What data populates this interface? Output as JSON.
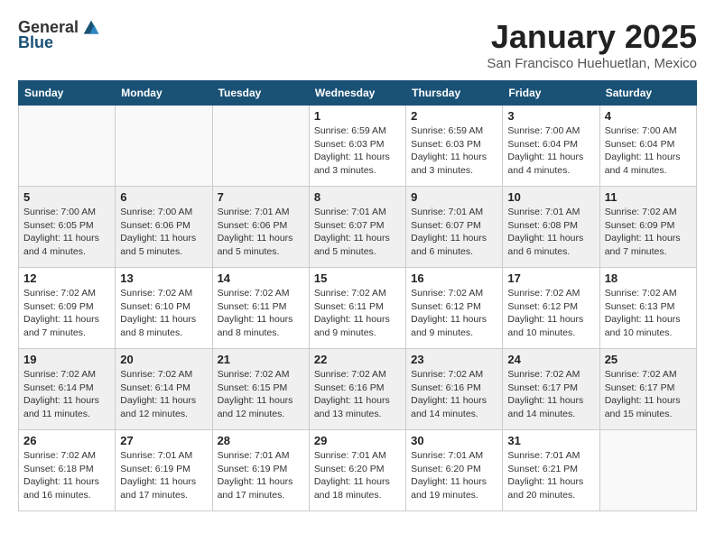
{
  "header": {
    "logo_general": "General",
    "logo_blue": "Blue",
    "title": "January 2025",
    "location": "San Francisco Huehuetlan, Mexico"
  },
  "weekdays": [
    "Sunday",
    "Monday",
    "Tuesday",
    "Wednesday",
    "Thursday",
    "Friday",
    "Saturday"
  ],
  "weeks": [
    [
      {
        "day": "",
        "info": ""
      },
      {
        "day": "",
        "info": ""
      },
      {
        "day": "",
        "info": ""
      },
      {
        "day": "1",
        "info": "Sunrise: 6:59 AM\nSunset: 6:03 PM\nDaylight: 11 hours\nand 3 minutes."
      },
      {
        "day": "2",
        "info": "Sunrise: 6:59 AM\nSunset: 6:03 PM\nDaylight: 11 hours\nand 3 minutes."
      },
      {
        "day": "3",
        "info": "Sunrise: 7:00 AM\nSunset: 6:04 PM\nDaylight: 11 hours\nand 4 minutes."
      },
      {
        "day": "4",
        "info": "Sunrise: 7:00 AM\nSunset: 6:04 PM\nDaylight: 11 hours\nand 4 minutes."
      }
    ],
    [
      {
        "day": "5",
        "info": "Sunrise: 7:00 AM\nSunset: 6:05 PM\nDaylight: 11 hours\nand 4 minutes."
      },
      {
        "day": "6",
        "info": "Sunrise: 7:00 AM\nSunset: 6:06 PM\nDaylight: 11 hours\nand 5 minutes."
      },
      {
        "day": "7",
        "info": "Sunrise: 7:01 AM\nSunset: 6:06 PM\nDaylight: 11 hours\nand 5 minutes."
      },
      {
        "day": "8",
        "info": "Sunrise: 7:01 AM\nSunset: 6:07 PM\nDaylight: 11 hours\nand 5 minutes."
      },
      {
        "day": "9",
        "info": "Sunrise: 7:01 AM\nSunset: 6:07 PM\nDaylight: 11 hours\nand 6 minutes."
      },
      {
        "day": "10",
        "info": "Sunrise: 7:01 AM\nSunset: 6:08 PM\nDaylight: 11 hours\nand 6 minutes."
      },
      {
        "day": "11",
        "info": "Sunrise: 7:02 AM\nSunset: 6:09 PM\nDaylight: 11 hours\nand 7 minutes."
      }
    ],
    [
      {
        "day": "12",
        "info": "Sunrise: 7:02 AM\nSunset: 6:09 PM\nDaylight: 11 hours\nand 7 minutes."
      },
      {
        "day": "13",
        "info": "Sunrise: 7:02 AM\nSunset: 6:10 PM\nDaylight: 11 hours\nand 8 minutes."
      },
      {
        "day": "14",
        "info": "Sunrise: 7:02 AM\nSunset: 6:11 PM\nDaylight: 11 hours\nand 8 minutes."
      },
      {
        "day": "15",
        "info": "Sunrise: 7:02 AM\nSunset: 6:11 PM\nDaylight: 11 hours\nand 9 minutes."
      },
      {
        "day": "16",
        "info": "Sunrise: 7:02 AM\nSunset: 6:12 PM\nDaylight: 11 hours\nand 9 minutes."
      },
      {
        "day": "17",
        "info": "Sunrise: 7:02 AM\nSunset: 6:12 PM\nDaylight: 11 hours\nand 10 minutes."
      },
      {
        "day": "18",
        "info": "Sunrise: 7:02 AM\nSunset: 6:13 PM\nDaylight: 11 hours\nand 10 minutes."
      }
    ],
    [
      {
        "day": "19",
        "info": "Sunrise: 7:02 AM\nSunset: 6:14 PM\nDaylight: 11 hours\nand 11 minutes."
      },
      {
        "day": "20",
        "info": "Sunrise: 7:02 AM\nSunset: 6:14 PM\nDaylight: 11 hours\nand 12 minutes."
      },
      {
        "day": "21",
        "info": "Sunrise: 7:02 AM\nSunset: 6:15 PM\nDaylight: 11 hours\nand 12 minutes."
      },
      {
        "day": "22",
        "info": "Sunrise: 7:02 AM\nSunset: 6:16 PM\nDaylight: 11 hours\nand 13 minutes."
      },
      {
        "day": "23",
        "info": "Sunrise: 7:02 AM\nSunset: 6:16 PM\nDaylight: 11 hours\nand 14 minutes."
      },
      {
        "day": "24",
        "info": "Sunrise: 7:02 AM\nSunset: 6:17 PM\nDaylight: 11 hours\nand 14 minutes."
      },
      {
        "day": "25",
        "info": "Sunrise: 7:02 AM\nSunset: 6:17 PM\nDaylight: 11 hours\nand 15 minutes."
      }
    ],
    [
      {
        "day": "26",
        "info": "Sunrise: 7:02 AM\nSunset: 6:18 PM\nDaylight: 11 hours\nand 16 minutes."
      },
      {
        "day": "27",
        "info": "Sunrise: 7:01 AM\nSunset: 6:19 PM\nDaylight: 11 hours\nand 17 minutes."
      },
      {
        "day": "28",
        "info": "Sunrise: 7:01 AM\nSunset: 6:19 PM\nDaylight: 11 hours\nand 17 minutes."
      },
      {
        "day": "29",
        "info": "Sunrise: 7:01 AM\nSunset: 6:20 PM\nDaylight: 11 hours\nand 18 minutes."
      },
      {
        "day": "30",
        "info": "Sunrise: 7:01 AM\nSunset: 6:20 PM\nDaylight: 11 hours\nand 19 minutes."
      },
      {
        "day": "31",
        "info": "Sunrise: 7:01 AM\nSunset: 6:21 PM\nDaylight: 11 hours\nand 20 minutes."
      },
      {
        "day": "",
        "info": ""
      }
    ]
  ]
}
